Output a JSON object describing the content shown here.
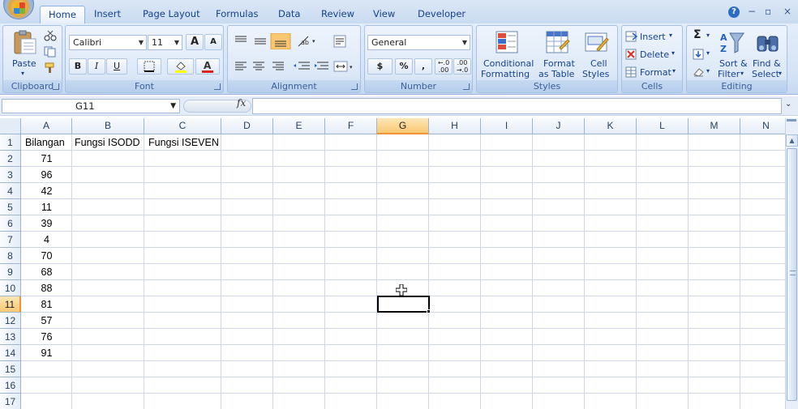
{
  "ribbon_tabs": [
    {
      "label": "Home",
      "active": true
    },
    {
      "label": "Insert"
    },
    {
      "label": "Page Layout"
    },
    {
      "label": "Formulas"
    },
    {
      "label": "Data"
    },
    {
      "label": "Review"
    },
    {
      "label": "View"
    },
    {
      "label": "Developer"
    }
  ],
  "window_controls": {
    "help": "?",
    "minimize": "−",
    "restore": "▫",
    "close": "×"
  },
  "clipboard": {
    "paste": "Paste",
    "group": "Clipboard"
  },
  "font": {
    "name": "Calibri",
    "size": "11",
    "group": "Font",
    "bold": "B",
    "italic": "I",
    "underline": "U",
    "grow": "A",
    "shrink": "A"
  },
  "alignment": {
    "group": "Alignment"
  },
  "number": {
    "format": "General",
    "currency": "$",
    "percent": "%",
    "comma": ",",
    "inc_decimal": "←.0 .00",
    "dec_decimal": ".00 →.0",
    "group": "Number"
  },
  "styles": {
    "conditional": [
      "Conditional",
      "Formatting"
    ],
    "format_table": [
      "Format",
      "as Table"
    ],
    "cell_styles": [
      "Cell",
      "Styles"
    ],
    "group": "Styles"
  },
  "cells": {
    "insert": "Insert",
    "delete": "Delete",
    "format": "Format",
    "group": "Cells"
  },
  "editing": {
    "sum": "Σ",
    "sort": [
      "Sort &",
      "Filter"
    ],
    "find": [
      "Find &",
      "Select"
    ],
    "group": "Editing"
  },
  "formula_bar": {
    "name_box": "G11",
    "fx": "fx",
    "formula": ""
  },
  "columns": [
    "A",
    "B",
    "C",
    "D",
    "E",
    "F",
    "G",
    "H",
    "I",
    "J",
    "K",
    "L",
    "M",
    "N"
  ],
  "selected_column": "G",
  "rows": [
    "1",
    "2",
    "3",
    "4",
    "5",
    "6",
    "7",
    "8",
    "9",
    "10",
    "11",
    "12",
    "13",
    "14",
    "15",
    "16",
    "17"
  ],
  "selected_row": "11",
  "sheet": {
    "headers": {
      "A1": "Bilangan",
      "B1": "Fungsi ISODD",
      "C1": "Fungsi ISEVEN"
    },
    "values": [
      "71",
      "96",
      "42",
      "11",
      "39",
      "4",
      "70",
      "68",
      "88",
      "81",
      "57",
      "76",
      "91"
    ]
  },
  "colors": {
    "accent": "#15428b",
    "selection": "#f9c771",
    "grid": "#d0d7e5"
  }
}
